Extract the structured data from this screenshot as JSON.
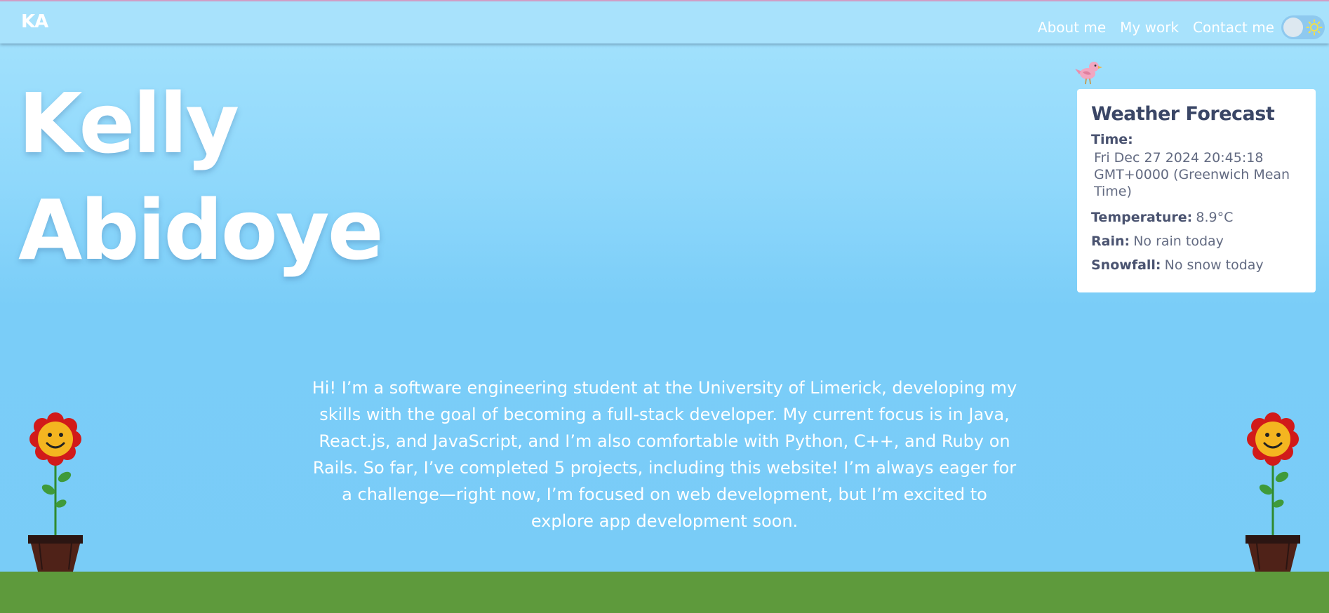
{
  "nav": {
    "logo": "KA",
    "links": [
      "About me",
      "My work",
      "Contact me"
    ],
    "theme_toggle_icon": "sun-icon"
  },
  "hero": {
    "first_name": "Kelly",
    "last_name": "Abidoye"
  },
  "weather": {
    "title": "Weather Forecast",
    "time_label": "Time:",
    "time_value": "Fri Dec 27 2024 20:45:18 GMT+0000 (Greenwich Mean Time)",
    "temperature_label": "Temperature:",
    "temperature_value": "8.9°C",
    "rain_label": "Rain:",
    "rain_value": "No rain today",
    "snowfall_label": "Snowfall:",
    "snowfall_value": "No snow today"
  },
  "about": {
    "text": "Hi! I’m a software engineering student at the University of Limerick, developing my skills with the goal of becoming a full-stack developer. My current focus is in Java, React.js, and JavaScript, and I’m also comfortable with Python, C++, and Ruby on Rails. So far, I’ve completed 5 projects, including this website! I’m always eager for a challenge—right now, I’m focused on web development, but I’m excited to explore app development soon."
  },
  "decorations": {
    "bird_icon": "bird-icon",
    "flower_icon": "flower-icon"
  },
  "colors": {
    "sky_top": "#a6e3fd",
    "sky_bottom": "#79ccf7",
    "ground": "#5e9a3c",
    "card_text": "#3a4666"
  }
}
